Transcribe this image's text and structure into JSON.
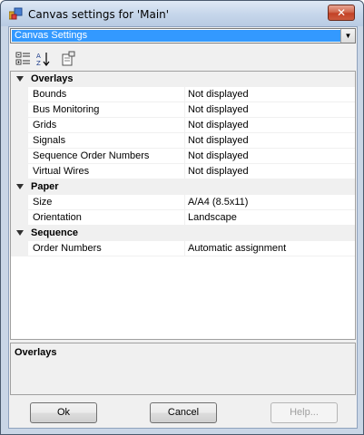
{
  "window": {
    "title": "Canvas settings for 'Main'",
    "close_glyph": "✕",
    "icon": "app-grid-icon"
  },
  "object_selector": {
    "value": "Canvas Settings",
    "arrow_glyph": "▼"
  },
  "toolbar": {
    "buttons": [
      {
        "name": "categorized-view-button",
        "icon": "categorized-icon"
      },
      {
        "name": "alphabetical-view-button",
        "icon": "sort-az-icon"
      },
      {
        "name": "property-pages-button",
        "icon": "property-pages-icon"
      }
    ]
  },
  "property_grid": {
    "categories": [
      {
        "label": "Overlays",
        "properties": [
          {
            "name": "Bounds",
            "value": "Not displayed"
          },
          {
            "name": "Bus Monitoring",
            "value": "Not displayed"
          },
          {
            "name": "Grids",
            "value": "Not displayed"
          },
          {
            "name": "Signals",
            "value": "Not displayed"
          },
          {
            "name": "Sequence Order Numbers",
            "value": "Not displayed"
          },
          {
            "name": "Virtual Wires",
            "value": "Not displayed"
          }
        ]
      },
      {
        "label": "Paper",
        "properties": [
          {
            "name": "Size",
            "value": "A/A4 (8.5x11)"
          },
          {
            "name": "Orientation",
            "value": "Landscape"
          }
        ]
      },
      {
        "label": "Sequence",
        "properties": [
          {
            "name": "Order Numbers",
            "value": "Automatic assignment"
          }
        ]
      }
    ]
  },
  "help_panel": {
    "title": "Overlays",
    "description": ""
  },
  "buttons": {
    "ok": "Ok",
    "cancel": "Cancel",
    "help": "Help..."
  },
  "colors": {
    "selection": "#3399ff",
    "close_button": "#c34226",
    "title_bar": "#c7d7eb",
    "category_background": "#f0f0f0"
  }
}
